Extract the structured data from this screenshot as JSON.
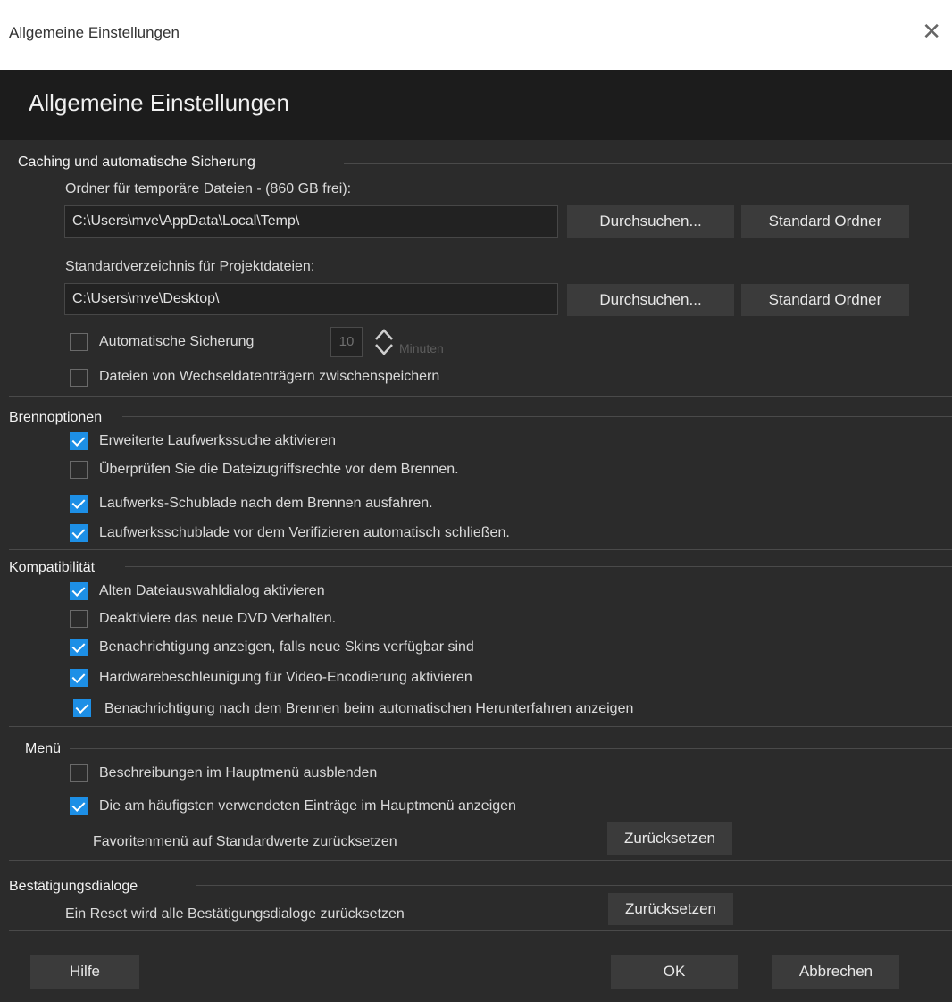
{
  "window": {
    "title": "Allgemeine Einstellungen",
    "close_icon": "close-icon"
  },
  "header": {
    "title": "Allgemeine Einstellungen"
  },
  "caching": {
    "heading": "Caching und automatische Sicherung",
    "temp_label": "Ordner für temporäre Dateien - (860 GB frei):",
    "temp_value": "C:\\Users\\mve\\AppData\\Local\\Temp\\",
    "project_label": "Standardverzeichnis für Projektdateien:",
    "project_value": "C:\\Users\\mve\\Desktop\\",
    "browse_label": "Durchsuchen...",
    "default_folder_label": "Standard Ordner",
    "autosave_label": "Automatische Sicherung",
    "autosave_checked": false,
    "autosave_minutes": "10",
    "minutes_label": "Minuten",
    "removable_label": "Dateien von Wechseldatenträgern zwischenspeichern",
    "removable_checked": false
  },
  "burn": {
    "heading": "Brennoptionen",
    "items": [
      {
        "label": "Erweiterte Laufwerkssuche aktivieren",
        "checked": true
      },
      {
        "label": "Überprüfen Sie die Dateizugriffsrechte vor dem Brennen.",
        "checked": false
      },
      {
        "label": "Laufwerks-Schublade nach dem Brennen ausfahren.",
        "checked": true
      },
      {
        "label": "Laufwerksschublade vor dem Verifizieren automatisch schließen.",
        "checked": true
      }
    ]
  },
  "compat": {
    "heading": "Kompatibilität",
    "items": [
      {
        "label": "Alten Dateiauswahldialog aktivieren",
        "checked": true
      },
      {
        "label": "Deaktiviere das neue DVD Verhalten.",
        "checked": false
      },
      {
        "label": "Benachrichtigung anzeigen, falls neue Skins verfügbar sind",
        "checked": true
      },
      {
        "label": "Hardwarebeschleunigung für Video-Encodierung aktivieren",
        "checked": true
      },
      {
        "label": "Benachrichtigung nach dem Brennen beim automatischen Herunterfahren anzeigen",
        "checked": true
      }
    ]
  },
  "menu": {
    "heading": "Menü",
    "items": [
      {
        "label": "Beschreibungen im Hauptmenü ausblenden",
        "checked": false
      },
      {
        "label": "Die am häufigsten verwendeten Einträge im Hauptmenü anzeigen",
        "checked": true
      }
    ],
    "favorites_label": "Favoritenmenü auf Standardwerte zurücksetzen",
    "reset_label": "Zurücksetzen"
  },
  "confirm": {
    "heading": "Bestätigungsdialoge",
    "text": "Ein Reset wird alle Bestätigungsdialoge zurücksetzen",
    "reset_label": "Zurücksetzen"
  },
  "footer": {
    "help_label": "Hilfe",
    "ok_label": "OK",
    "cancel_label": "Abbrechen"
  },
  "colors": {
    "accent": "#1d8fe6",
    "background": "#2b2b2b",
    "button": "#3b3b3b"
  }
}
